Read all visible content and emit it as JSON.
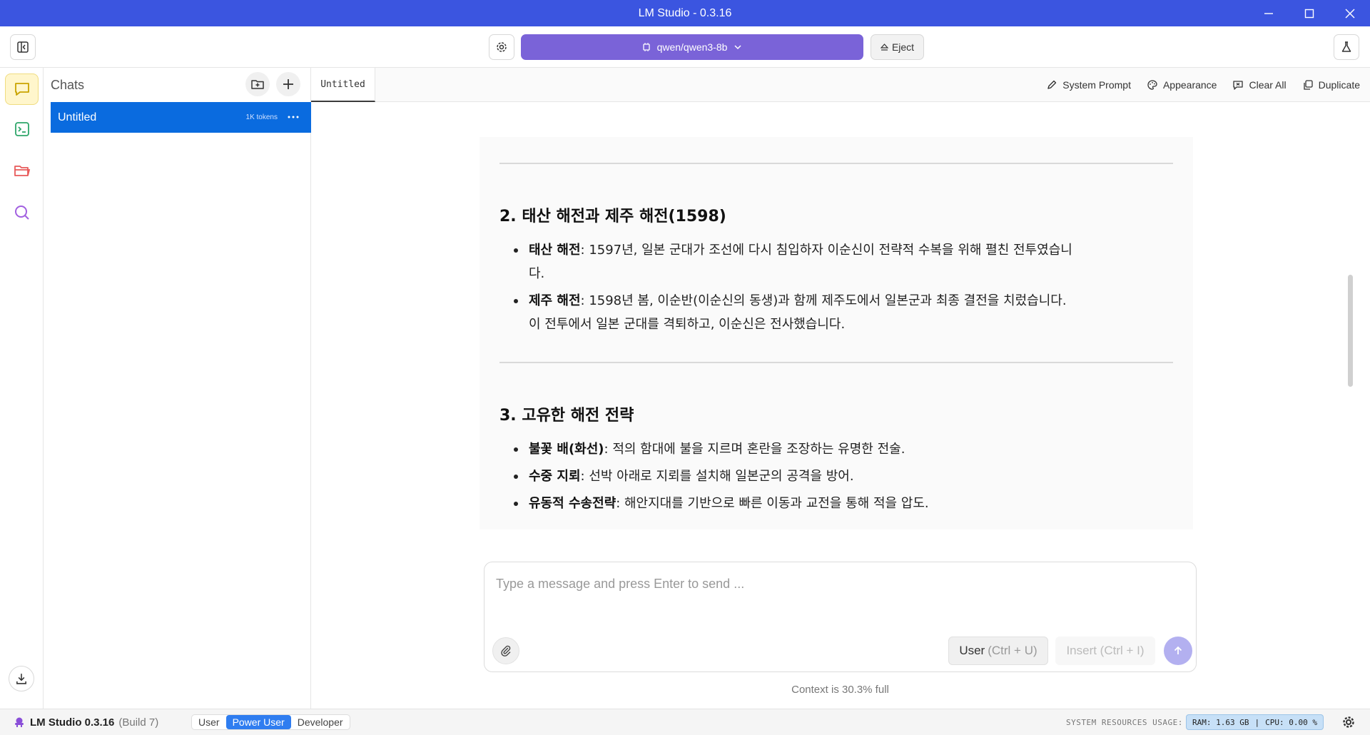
{
  "window": {
    "title": "LM Studio - 0.3.16"
  },
  "toolbar": {
    "model_name": "qwen/qwen3-8b",
    "eject_label": "Eject"
  },
  "chats": {
    "title": "Chats",
    "items": [
      {
        "label": "Untitled",
        "tokens": "1K tokens"
      }
    ]
  },
  "tabs": [
    {
      "label": "Untitled"
    }
  ],
  "tab_actions": {
    "system_prompt": "System Prompt",
    "appearance": "Appearance",
    "clear_all": "Clear All",
    "duplicate": "Duplicate"
  },
  "content": {
    "sections": [
      {
        "title": "2. 태산 해전과 제주 해전(1598)",
        "items": [
          {
            "term": "태산 해전",
            "lines": [
              "1597년, 일본 군대가 조선에 다시 침입하자 이순신이 전략적 수복을 위해 펼친 전투였습니",
              "다."
            ]
          },
          {
            "term": "제주 해전",
            "lines": [
              "1598년 봄, 이순반(이순신의 동생)과 함께 제주도에서 일본군과 최종 결전을 치렀습니다.",
              "이 전투에서 일본 군대를 격퇴하고, 이순신은 전사했습니다."
            ]
          }
        ]
      },
      {
        "title": "3. 고유한 해전 전략",
        "items": [
          {
            "term": "불꽃 배(화선)",
            "lines": [
              "적의 함대에 불을 지르며 혼란을 조장하는 유명한 전술."
            ]
          },
          {
            "term": "수중 지뢰",
            "lines": [
              "선박 아래로 지뢰를 설치해 일본군의 공격을 방어."
            ]
          },
          {
            "term": "유동적 수송전략",
            "lines": [
              "해안지대를 기반으로 빠른 이동과 교전을 통해 적을 압도."
            ]
          }
        ]
      }
    ]
  },
  "input": {
    "placeholder": "Type a message and press Enter to send ...",
    "user_label": "User",
    "user_hint": "(Ctrl + U)",
    "insert_label": "Insert (Ctrl + I)"
  },
  "context_text": "Context is 30.3% full",
  "status": {
    "app_name": "LM Studio 0.3.16",
    "build": "(Build 7)",
    "modes": [
      "User",
      "Power User",
      "Developer"
    ],
    "active_mode": "Power User",
    "resources_label": "SYSTEM RESOURCES USAGE:",
    "ram": "RAM: 1.63 GB",
    "separator": "|",
    "cpu": "CPU: 0.00 %"
  },
  "colors": {
    "titlebar": "#3b55e0",
    "model_pill": "#7a63d8",
    "selected_chat": "#0a6bdf",
    "active_mode": "#2f7df0"
  }
}
